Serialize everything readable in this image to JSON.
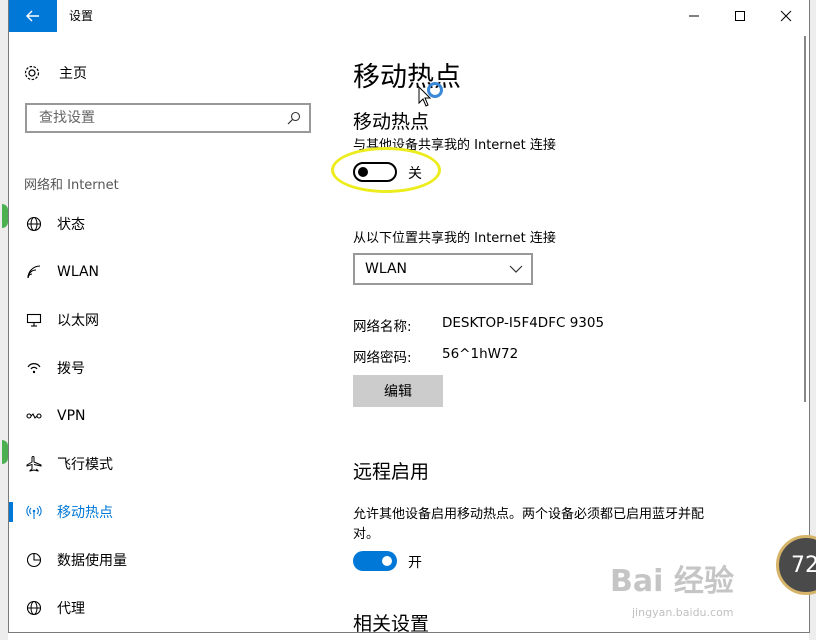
{
  "window": {
    "title": "设置"
  },
  "sidebar": {
    "home_label": "主页",
    "search_placeholder": "查找设置",
    "category": "网络和 Internet",
    "items": [
      {
        "label": "状态",
        "icon": "globe-icon"
      },
      {
        "label": "WLAN",
        "icon": "wifi-icon"
      },
      {
        "label": "以太网",
        "icon": "ethernet-icon"
      },
      {
        "label": "拨号",
        "icon": "dialup-icon"
      },
      {
        "label": "VPN",
        "icon": "vpn-icon"
      },
      {
        "label": "飞行模式",
        "icon": "airplane-icon"
      },
      {
        "label": "移动热点",
        "icon": "hotspot-icon",
        "active": true
      },
      {
        "label": "数据使用量",
        "icon": "pie-chart-icon"
      },
      {
        "label": "代理",
        "icon": "globe-icon"
      }
    ]
  },
  "main": {
    "page_title": "移动热点",
    "hotspot": {
      "heading": "移动热点",
      "description": "与其他设备共享我的 Internet 连接",
      "toggle_state": "关",
      "toggle_on": false
    },
    "share_from": {
      "label": "从以下位置共享我的 Internet 连接",
      "selected": "WLAN"
    },
    "network_name_label": "网络名称:",
    "network_name_value": "DESKTOP-I5F4DFC 9305",
    "network_password_label": "网络密码:",
    "network_password_value": "56^1hW72",
    "edit_label": "编辑",
    "remote": {
      "heading": "远程启用",
      "description_line1": "允许其他设备启用移动热点。两个设备必须都已启用蓝牙并配",
      "description_line2": "对。",
      "toggle_state": "开",
      "toggle_on": true
    },
    "related_heading": "相关设置"
  },
  "overlay": {
    "badge_number": "72",
    "watermark": "Bai 经验",
    "watermark_sub": "jingyan.baidu.com"
  },
  "colors": {
    "accent": "#0078d7",
    "highlight": "#ecec1e"
  }
}
